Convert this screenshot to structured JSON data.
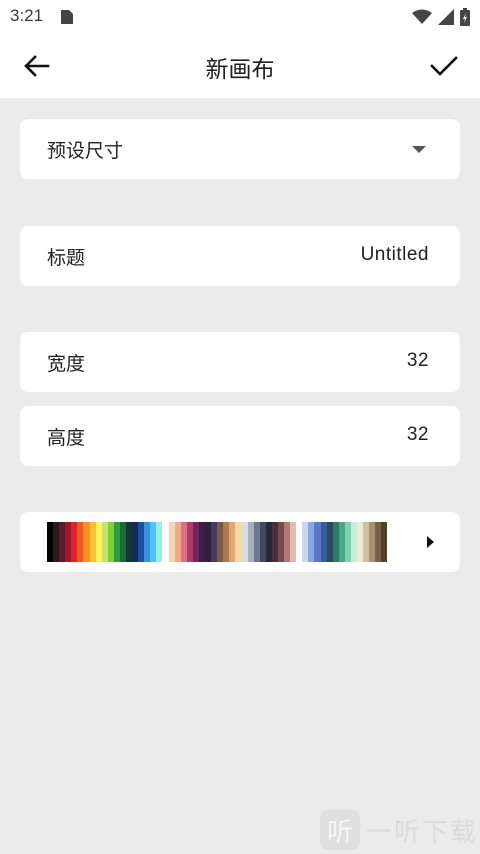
{
  "status_bar": {
    "time": "3:21",
    "icons": [
      "sim-card-icon",
      "wifi-icon",
      "signal-icon",
      "battery-charging-icon"
    ]
  },
  "app_bar": {
    "title": "新画布",
    "back_icon": "arrow-left-icon",
    "confirm_icon": "check-icon"
  },
  "preset": {
    "label": "预设尺寸",
    "icon": "dropdown-arrow-icon"
  },
  "title_field": {
    "label": "标题",
    "value": "Untitled"
  },
  "width_field": {
    "label": "宽度",
    "value": "32"
  },
  "height_field": {
    "label": "高度",
    "value": "32"
  },
  "palette": {
    "icon": "play-arrow-icon",
    "colors": [
      "#000000",
      "#2a1a1e",
      "#5a1c2a",
      "#a3132a",
      "#e0222b",
      "#ef5a1e",
      "#f7931e",
      "#fbc02d",
      "#fff35c",
      "#c8e26a",
      "#7fcf3a",
      "#2e9e3c",
      "#1a6b3a",
      "#0f3b2e",
      "#152a57",
      "#1e4fa8",
      "#3a8fe0",
      "#4fc3f7",
      "#8ff0e6",
      "#ffffff",
      "#f6d5b0",
      "#f3a98c",
      "#e06d8a",
      "#b03a6c",
      "#6b2a5e",
      "#3b1e4a",
      "#2a2440",
      "#4a3a5a",
      "#7a5a4a",
      "#b07a50",
      "#e0a870",
      "#f5d8a8",
      "#dcdcdc",
      "#a8b0c0",
      "#6c7890",
      "#3f4a60",
      "#28283a",
      "#4a3038",
      "#7a4a50",
      "#b07a78",
      "#e8b8a8",
      "#ffffff",
      "#c8d8f0",
      "#8aa8e0",
      "#5a78c8",
      "#385a98",
      "#2a4a5a",
      "#2a7a6a",
      "#48a888",
      "#80d0b0",
      "#c8ecd8",
      "#f0ead0",
      "#d0c0a0",
      "#a89070",
      "#786048",
      "#504030"
    ]
  },
  "watermark": {
    "logo_glyph": "听",
    "text": "一听下载"
  }
}
